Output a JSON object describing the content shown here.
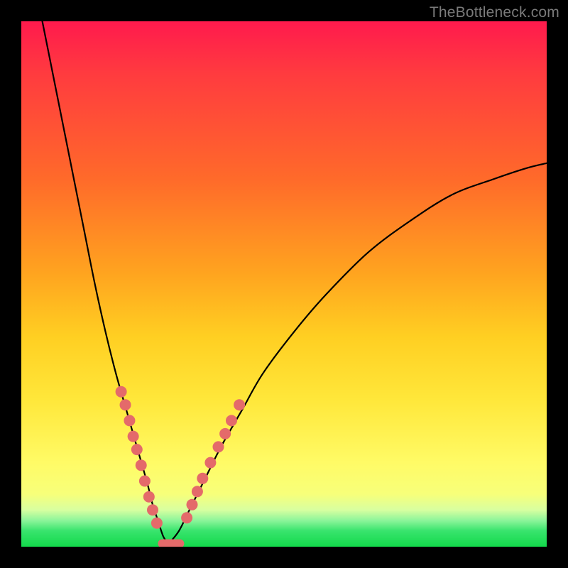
{
  "watermark": "TheBottleneck.com",
  "gradient_colors": {
    "top": "#ff1a4d",
    "mid_upper": "#ff6a2a",
    "mid": "#ffcf22",
    "mid_lower": "#fffb66",
    "bottom": "#13d94b"
  },
  "chart_data": {
    "type": "line",
    "title": "",
    "xlabel": "",
    "ylabel": "",
    "xlim": [
      0,
      100
    ],
    "ylim": [
      0,
      100
    ],
    "note": "Values are percentages of plot width/height, y=0 at bottom. Bottleneck-style V curve with minimum near x≈28. Axis has no numeric ticks in the image; values are estimated from pixel positions.",
    "series": [
      {
        "name": "left-branch",
        "x": [
          4,
          6,
          8,
          10,
          12,
          14,
          16,
          18,
          20,
          22,
          24,
          25,
          26,
          27,
          28
        ],
        "y": [
          100,
          90,
          80,
          70,
          60,
          50,
          41,
          33,
          26,
          19,
          12,
          8,
          5,
          2,
          0.5
        ]
      },
      {
        "name": "right-branch",
        "x": [
          28,
          30,
          32,
          35,
          38,
          42,
          46,
          52,
          58,
          66,
          74,
          82,
          90,
          96,
          100
        ],
        "y": [
          0.5,
          3,
          7,
          13,
          19,
          26,
          33,
          41,
          48,
          56,
          62,
          67,
          70,
          72,
          73
        ]
      }
    ],
    "marker_clusters": [
      {
        "name": "left-dots",
        "branch": "left-branch",
        "points": [
          {
            "x": 19.0,
            "y": 29.5
          },
          {
            "x": 19.8,
            "y": 27.0
          },
          {
            "x": 20.6,
            "y": 24.0
          },
          {
            "x": 21.3,
            "y": 21.0
          },
          {
            "x": 22.0,
            "y": 18.5
          },
          {
            "x": 22.8,
            "y": 15.5
          },
          {
            "x": 23.5,
            "y": 12.5
          },
          {
            "x": 24.3,
            "y": 9.5
          },
          {
            "x": 25.0,
            "y": 7.0
          },
          {
            "x": 25.8,
            "y": 4.5
          }
        ]
      },
      {
        "name": "right-dots",
        "branch": "right-branch",
        "points": [
          {
            "x": 31.5,
            "y": 5.5
          },
          {
            "x": 32.5,
            "y": 8.0
          },
          {
            "x": 33.5,
            "y": 10.5
          },
          {
            "x": 34.5,
            "y": 13.0
          },
          {
            "x": 36.0,
            "y": 16.0
          },
          {
            "x": 37.5,
            "y": 19.0
          },
          {
            "x": 38.8,
            "y": 21.5
          },
          {
            "x": 40.0,
            "y": 24.0
          },
          {
            "x": 41.5,
            "y": 27.0
          }
        ]
      }
    ],
    "bottom_pill": {
      "x_start": 26.0,
      "x_end": 31.0,
      "y": 0.6
    }
  }
}
